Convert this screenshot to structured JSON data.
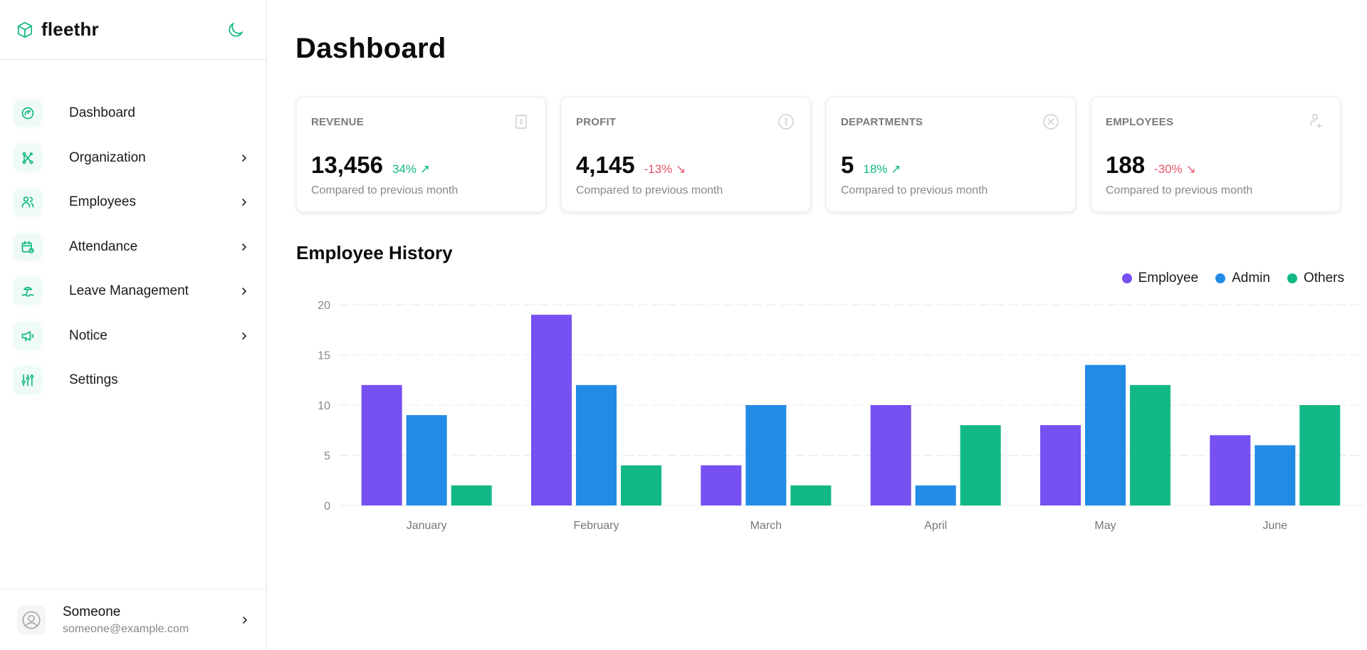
{
  "app": {
    "name": "fleethr",
    "logo_icon": "cube-icon",
    "theme_toggle_icon": "moon-icon"
  },
  "sidebar": {
    "items": [
      {
        "label": "Dashboard",
        "icon": "dashboard-gauge-icon",
        "has_submenu": false,
        "active": true
      },
      {
        "label": "Organization",
        "icon": "organization-network-icon",
        "has_submenu": true
      },
      {
        "label": "Employees",
        "icon": "users-icon",
        "has_submenu": true
      },
      {
        "label": "Attendance",
        "icon": "calendar-clock-icon",
        "has_submenu": true
      },
      {
        "label": "Leave Management",
        "icon": "beach-umbrella-icon",
        "has_submenu": true
      },
      {
        "label": "Notice",
        "icon": "megaphone-icon",
        "has_submenu": true
      },
      {
        "label": "Settings",
        "icon": "sliders-icon",
        "has_submenu": false
      }
    ],
    "user": {
      "name": "Someone",
      "email": "someone@example.com",
      "avatar_icon": "user-circle-icon"
    }
  },
  "main": {
    "title": "Dashboard",
    "cards": [
      {
        "label": "REVENUE",
        "value": "13,456",
        "delta": "34%",
        "direction": "up",
        "arrow": "↗",
        "subtitle": "Compared to previous month",
        "icon": "banknote-icon"
      },
      {
        "label": "PROFIT",
        "value": "4,145",
        "delta": "-13%",
        "direction": "down",
        "arrow": "↘",
        "subtitle": "Compared to previous month",
        "icon": "coin-icon"
      },
      {
        "label": "DEPARTMENTS",
        "value": "5",
        "delta": "18%",
        "direction": "up",
        "arrow": "↗",
        "subtitle": "Compared to previous month",
        "icon": "building-circle-icon"
      },
      {
        "label": "EMPLOYEES",
        "value": "188",
        "delta": "-30%",
        "direction": "down",
        "arrow": "↘",
        "subtitle": "Compared to previous month",
        "icon": "user-plus-icon"
      }
    ]
  },
  "colors": {
    "accent": "#10b981",
    "employee": "#7650f0",
    "admin": "#228be6",
    "others": "#12b886",
    "up": "#10b981",
    "down": "#e8546b"
  },
  "chart_data": {
    "type": "bar",
    "title": "Employee History",
    "categories": [
      "January",
      "February",
      "March",
      "April",
      "May",
      "June"
    ],
    "series": [
      {
        "name": "Employee",
        "color": "#7650f0",
        "values": [
          12,
          19,
          4,
          10,
          8,
          7
        ]
      },
      {
        "name": "Admin",
        "color": "#228be6",
        "values": [
          9,
          12,
          10,
          2,
          14,
          6
        ]
      },
      {
        "name": "Others",
        "color": "#12b886",
        "values": [
          2,
          4,
          2,
          8,
          12,
          10
        ]
      }
    ],
    "yticks": [
      0,
      5,
      10,
      15,
      20
    ],
    "ylim": [
      0,
      20
    ],
    "xlabel": "",
    "ylabel": "",
    "grid": true,
    "legend_position": "top-right"
  }
}
